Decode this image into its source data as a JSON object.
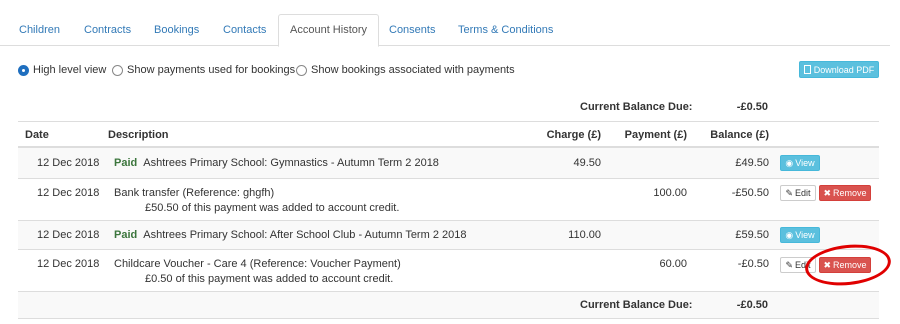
{
  "tabs": [
    {
      "label": "Children"
    },
    {
      "label": "Contracts"
    },
    {
      "label": "Bookings"
    },
    {
      "label": "Contacts"
    },
    {
      "label": "Account History",
      "active": true
    },
    {
      "label": "Consents"
    },
    {
      "label": "Terms & Conditions"
    }
  ],
  "view_options": [
    {
      "label": "High level view",
      "selected": true
    },
    {
      "label": "Show payments used for bookings",
      "selected": false
    },
    {
      "label": "Show bookings associated with payments",
      "selected": false
    }
  ],
  "download_pdf_label": "Download PDF",
  "balance_top": {
    "label": "Current Balance Due:",
    "value": "-£0.50"
  },
  "columns": {
    "date": "Date",
    "description": "Description",
    "charge": "Charge (£)",
    "payment": "Payment (£)",
    "balance": "Balance (£)"
  },
  "rows": [
    {
      "date": "12 Dec 2018",
      "paid_label": "Paid",
      "description": "Ashtrees Primary School: Gymnastics - Autumn Term 2 2018",
      "note": "",
      "charge": "49.50",
      "payment": "",
      "balance": "£49.50",
      "actions": [
        "View"
      ]
    },
    {
      "date": "12 Dec 2018",
      "paid_label": "",
      "description": "Bank transfer (Reference: ghgfh)",
      "note": "£50.50 of this payment was added to account credit.",
      "charge": "",
      "payment": "100.00",
      "balance": "-£50.50",
      "actions": [
        "Edit",
        "Remove"
      ]
    },
    {
      "date": "12 Dec 2018",
      "paid_label": "Paid",
      "description": "Ashtrees Primary School: After School Club - Autumn Term 2 2018",
      "note": "",
      "charge": "110.00",
      "payment": "",
      "balance": "£59.50",
      "actions": [
        "View"
      ]
    },
    {
      "date": "12 Dec 2018",
      "paid_label": "",
      "description": "Childcare Voucher - Care 4 (Reference: Voucher Payment)",
      "note": "£0.50 of this payment was added to account credit.",
      "charge": "",
      "payment": "60.00",
      "balance": "-£0.50",
      "actions": [
        "Edit",
        "Remove"
      ]
    }
  ],
  "balance_bottom": {
    "label": "Current Balance Due:",
    "value": "-£0.50"
  },
  "buttons": {
    "view": "View",
    "edit": "Edit",
    "remove": "Remove"
  },
  "icons": {
    "view": "eye-icon",
    "edit": "pencil-icon",
    "remove": "times-icon",
    "pdf": "file-pdf-icon"
  },
  "colors": {
    "link": "#337ab7",
    "info": "#5bc0de",
    "danger": "#d9534f",
    "paid": "#3c763d",
    "annotation": "#e00000"
  }
}
